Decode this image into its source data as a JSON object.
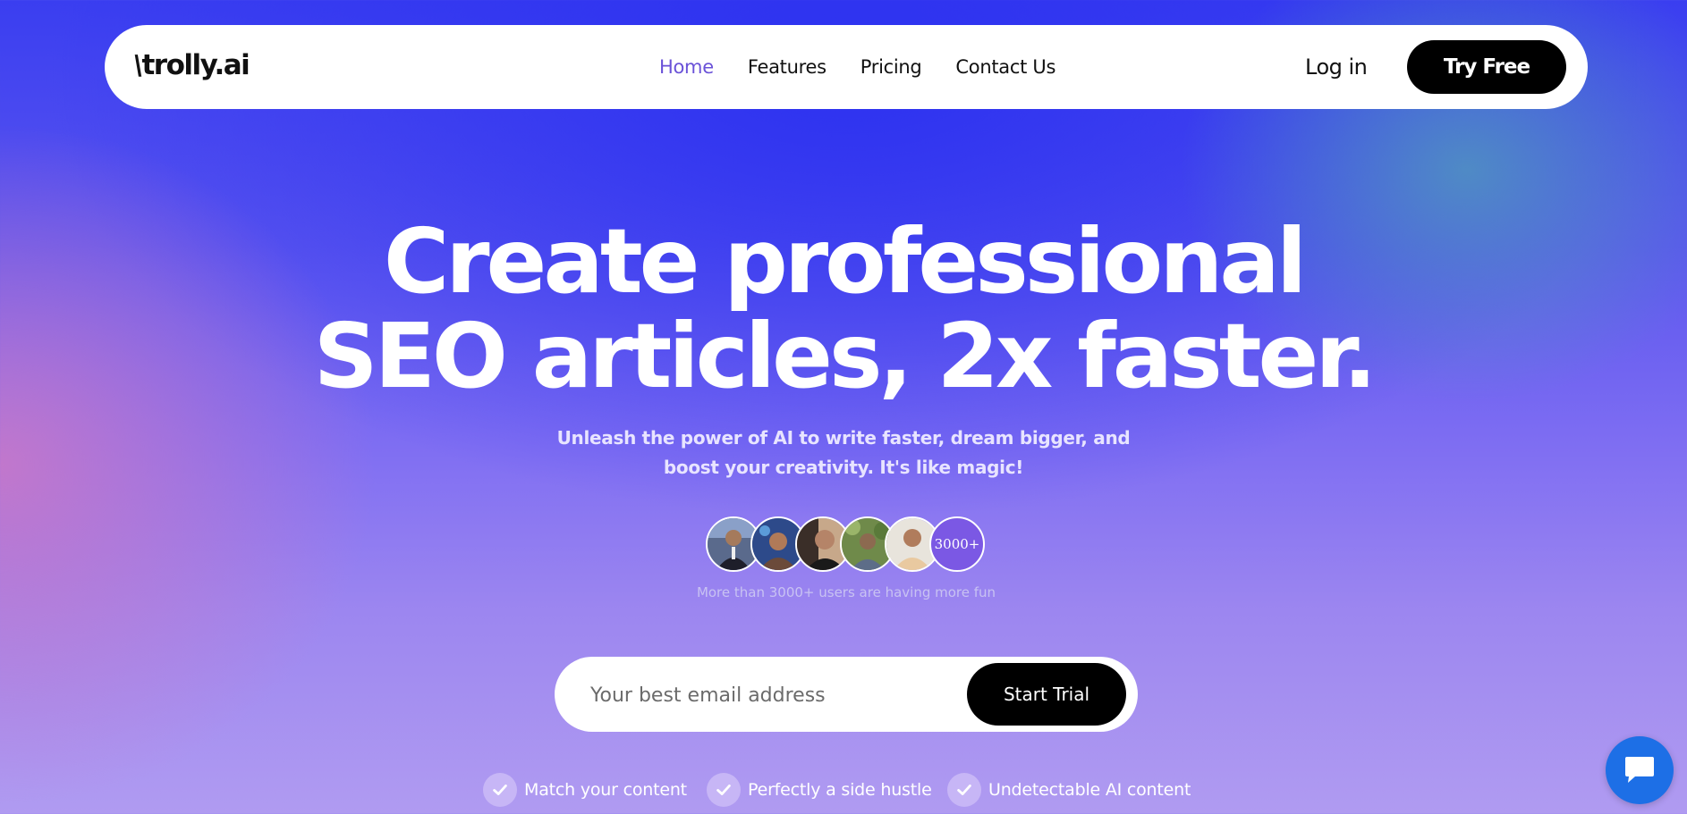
{
  "brand": {
    "logo_text": "trolly.ai"
  },
  "nav": {
    "links": [
      {
        "label": "Home",
        "active": true
      },
      {
        "label": "Features",
        "active": false
      },
      {
        "label": "Pricing",
        "active": false
      },
      {
        "label": "Contact Us",
        "active": false
      }
    ],
    "login_label": "Log in",
    "cta_label": "Try Free"
  },
  "hero": {
    "title_line1": "Create professional",
    "title_line2": "SEO articles, 2x faster.",
    "subtitle": "Unleash the power of AI to write faster, dream bigger, and boost your creativity. It's like magic!",
    "user_count_badge": "3000+",
    "users_text": "More than 3000+ users are having more fun"
  },
  "signup": {
    "email_placeholder": "Your best email address",
    "button_label": "Start Trial"
  },
  "features": [
    {
      "label": "Match your content",
      "icon": "check-icon"
    },
    {
      "label": "Perfectly a side hustle",
      "icon": "check-icon"
    },
    {
      "label": "Undetectable AI content",
      "icon": "check-icon"
    }
  ],
  "colors": {
    "active_link": "#6a52d8",
    "cta_bg": "#000000",
    "badge_bg": "#7b58e4",
    "chat_bg": "#1d6fe6"
  }
}
